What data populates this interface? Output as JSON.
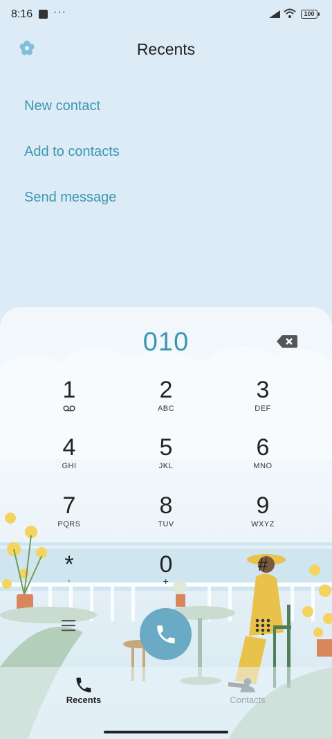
{
  "status_bar": {
    "time": "8:16",
    "more": "···",
    "battery": "100"
  },
  "header": {
    "title": "Recents",
    "settings_icon": "flower-settings-icon"
  },
  "actions": [
    {
      "label": "New contact"
    },
    {
      "label": "Add to contacts"
    },
    {
      "label": "Send message"
    }
  ],
  "dialer": {
    "number": "010",
    "keys": [
      {
        "digit": "1",
        "letters": ""
      },
      {
        "digit": "2",
        "letters": "ABC"
      },
      {
        "digit": "3",
        "letters": "DEF"
      },
      {
        "digit": "4",
        "letters": "GHI"
      },
      {
        "digit": "5",
        "letters": "JKL"
      },
      {
        "digit": "6",
        "letters": "MNO"
      },
      {
        "digit": "7",
        "letters": "PQRS"
      },
      {
        "digit": "8",
        "letters": "TUV"
      },
      {
        "digit": "9",
        "letters": "WXYZ"
      },
      {
        "digit": "*",
        "letters": ","
      },
      {
        "digit": "0",
        "letters": "+"
      },
      {
        "digit": "#",
        "letters": ""
      }
    ]
  },
  "tabs": [
    {
      "label": "Recents",
      "active": true
    },
    {
      "label": "Contacts",
      "active": false
    }
  ],
  "colors": {
    "accent": "#3a97b0",
    "call_button": "#6aaac4",
    "background": "#dcebf6"
  }
}
